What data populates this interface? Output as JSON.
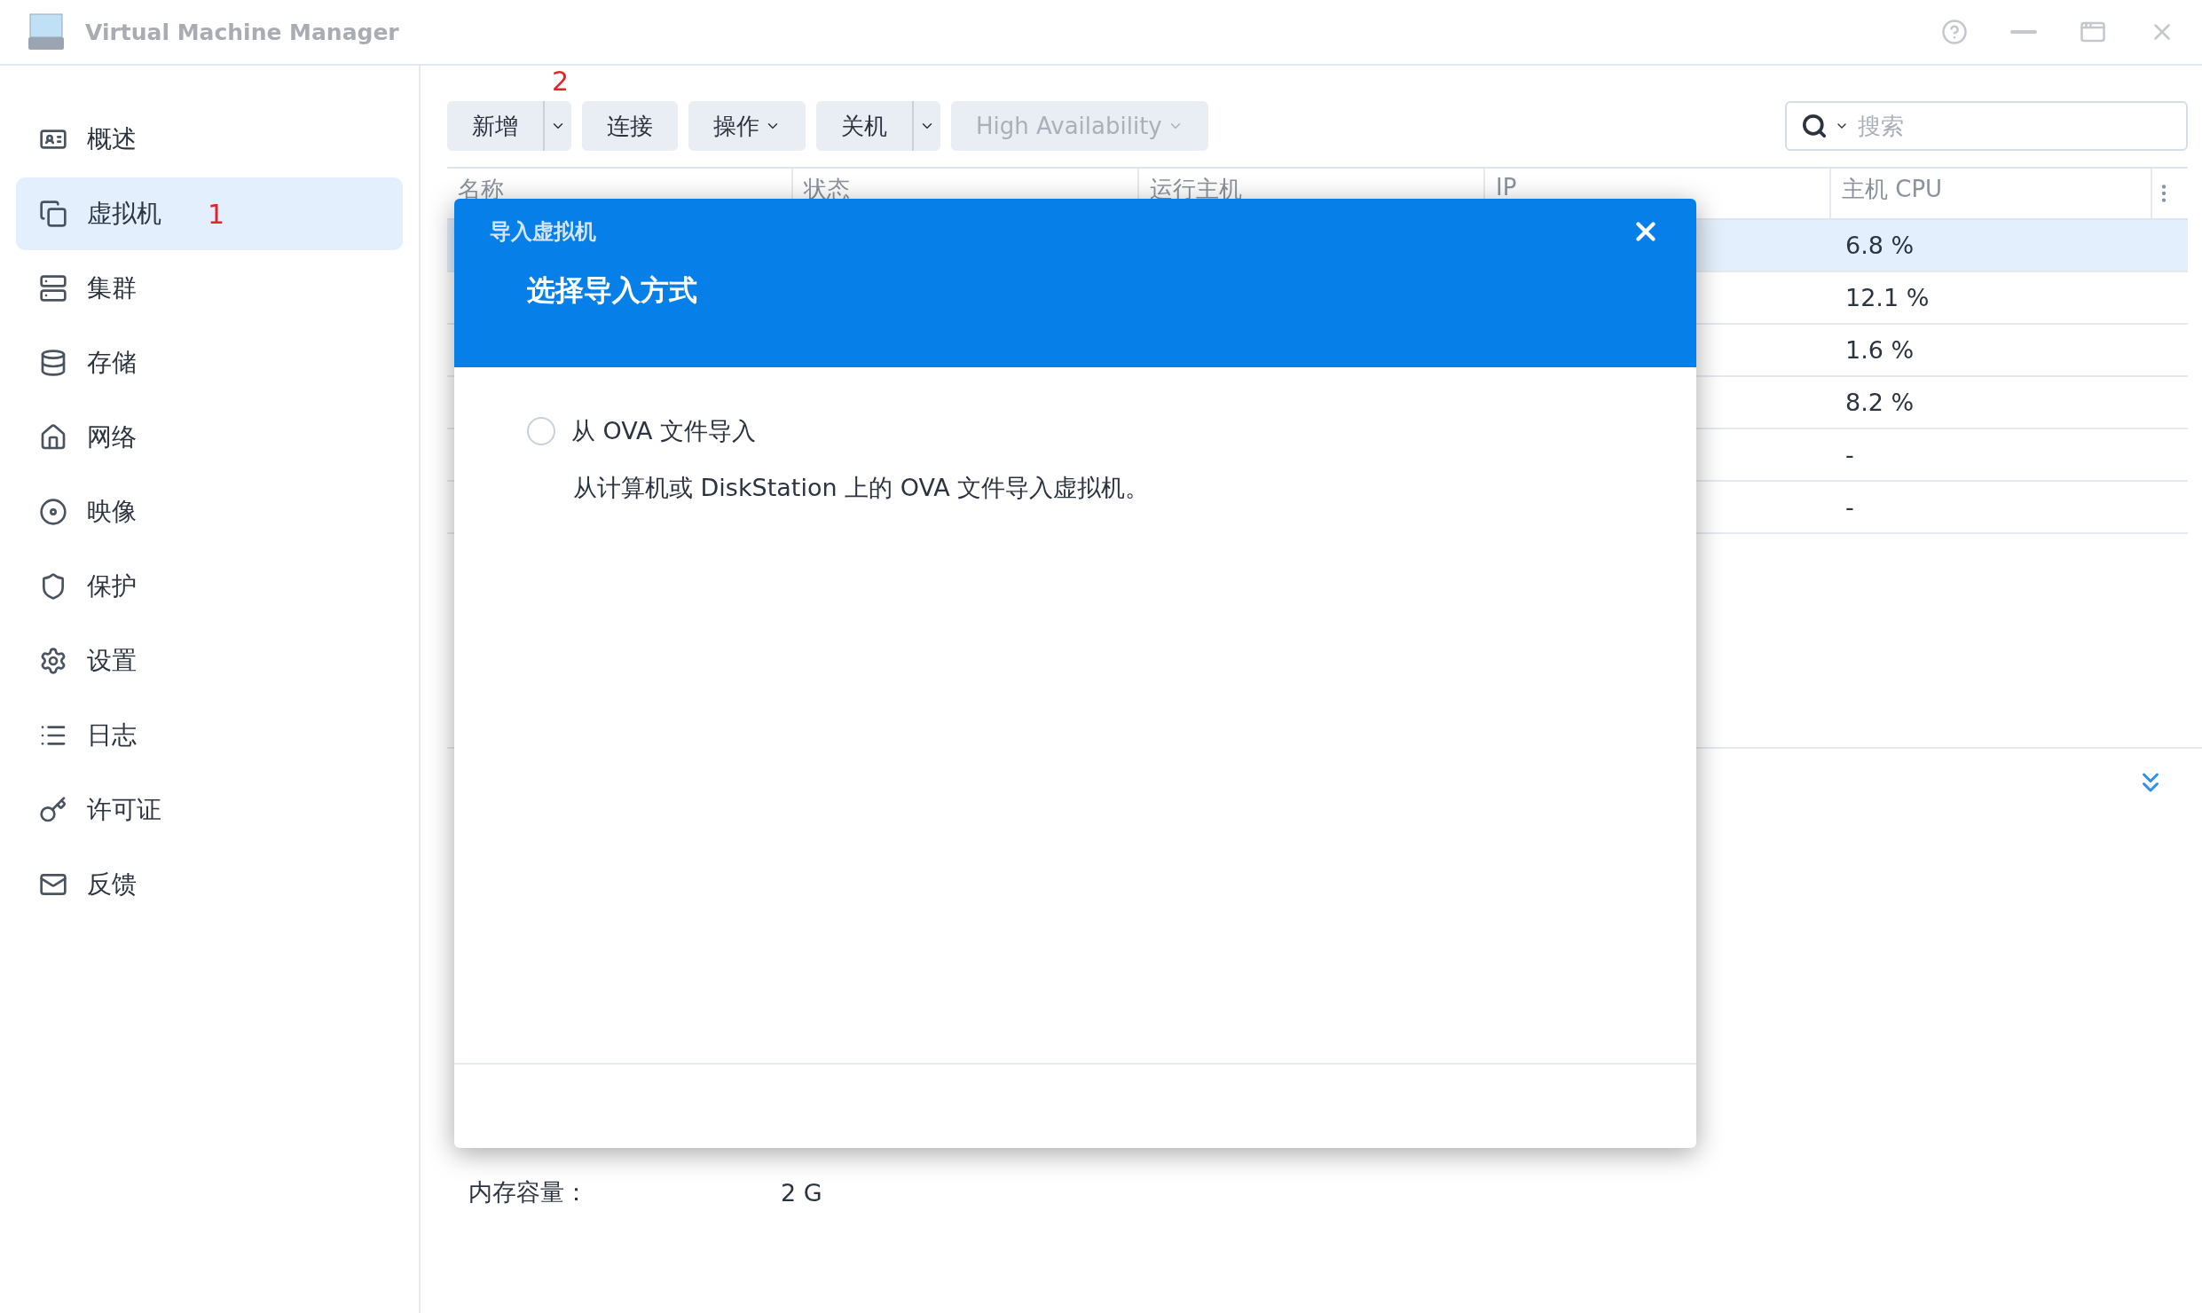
{
  "window": {
    "title": "Virtual Machine Manager"
  },
  "sidebar": {
    "items": [
      {
        "label": "概述",
        "selected": false
      },
      {
        "label": "虚拟机",
        "selected": true,
        "note": "1"
      },
      {
        "label": "集群",
        "selected": false
      },
      {
        "label": "存储",
        "selected": false
      },
      {
        "label": "网络",
        "selected": false
      },
      {
        "label": "映像",
        "selected": false
      },
      {
        "label": "保护",
        "selected": false
      },
      {
        "label": "设置",
        "selected": false
      },
      {
        "label": "日志",
        "selected": false
      },
      {
        "label": "许可证",
        "selected": false
      },
      {
        "label": "反馈",
        "selected": false
      }
    ]
  },
  "toolbar": {
    "note": "2",
    "buttons": [
      {
        "label": "新增",
        "kind": "split",
        "disabled": false
      },
      {
        "label": "连接",
        "kind": "plain",
        "disabled": false
      },
      {
        "label": "操作",
        "kind": "menu",
        "disabled": false
      },
      {
        "label": "关机",
        "kind": "split",
        "disabled": false
      },
      {
        "label": "High Availability",
        "kind": "menu",
        "disabled": true
      }
    ]
  },
  "search": {
    "placeholder": "搜索"
  },
  "table": {
    "columns": [
      "名称",
      "状态",
      "运行主机",
      "IP",
      "主机 CPU"
    ],
    "rows": [
      {
        "cpu": "6.8 %",
        "selected": true
      },
      {
        "cpu": "12.1 %",
        "selected": false
      },
      {
        "cpu": "1.6 %",
        "selected": false
      },
      {
        "cpu": "8.2 %",
        "selected": false
      },
      {
        "cpu": "-",
        "selected": false
      },
      {
        "cpu": "-",
        "selected": false
      }
    ]
  },
  "details": [
    {
      "label": "内存容量：",
      "value": "2 G"
    }
  ],
  "dialog": {
    "title": "导入虚拟机",
    "heading": "选择导入方式",
    "options": [
      {
        "label": "从 OVA 文件导入",
        "description": "从计算机或 DiskStation 上的 OVA 文件导入虚拟机。",
        "selected": false
      }
    ]
  }
}
